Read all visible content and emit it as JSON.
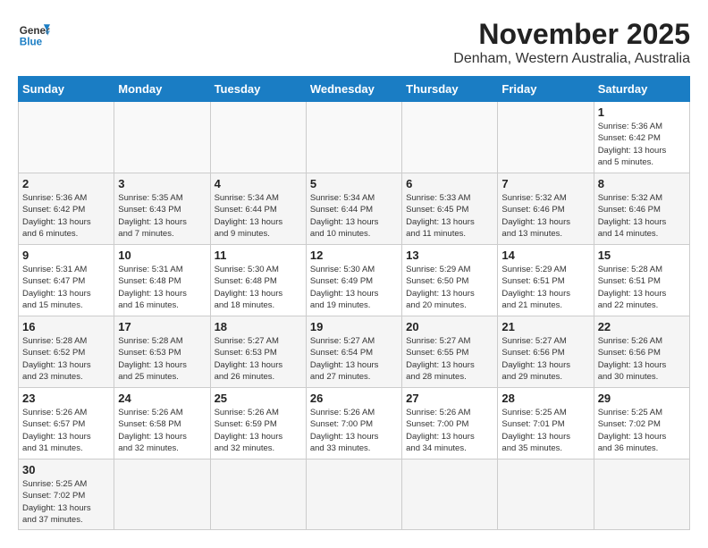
{
  "header": {
    "logo_general": "General",
    "logo_blue": "Blue",
    "title": "November 2025",
    "subtitle": "Denham, Western Australia, Australia"
  },
  "weekdays": [
    "Sunday",
    "Monday",
    "Tuesday",
    "Wednesday",
    "Thursday",
    "Friday",
    "Saturday"
  ],
  "weeks": [
    [
      {
        "day": "",
        "info": ""
      },
      {
        "day": "",
        "info": ""
      },
      {
        "day": "",
        "info": ""
      },
      {
        "day": "",
        "info": ""
      },
      {
        "day": "",
        "info": ""
      },
      {
        "day": "",
        "info": ""
      },
      {
        "day": "1",
        "info": "Sunrise: 5:36 AM\nSunset: 6:42 PM\nDaylight: 13 hours\nand 5 minutes."
      }
    ],
    [
      {
        "day": "2",
        "info": "Sunrise: 5:36 AM\nSunset: 6:42 PM\nDaylight: 13 hours\nand 6 minutes."
      },
      {
        "day": "3",
        "info": "Sunrise: 5:35 AM\nSunset: 6:43 PM\nDaylight: 13 hours\nand 7 minutes."
      },
      {
        "day": "4",
        "info": "Sunrise: 5:34 AM\nSunset: 6:44 PM\nDaylight: 13 hours\nand 9 minutes."
      },
      {
        "day": "5",
        "info": "Sunrise: 5:34 AM\nSunset: 6:44 PM\nDaylight: 13 hours\nand 10 minutes."
      },
      {
        "day": "6",
        "info": "Sunrise: 5:33 AM\nSunset: 6:45 PM\nDaylight: 13 hours\nand 11 minutes."
      },
      {
        "day": "7",
        "info": "Sunrise: 5:32 AM\nSunset: 6:46 PM\nDaylight: 13 hours\nand 13 minutes."
      },
      {
        "day": "8",
        "info": "Sunrise: 5:32 AM\nSunset: 6:46 PM\nDaylight: 13 hours\nand 14 minutes."
      }
    ],
    [
      {
        "day": "9",
        "info": "Sunrise: 5:31 AM\nSunset: 6:47 PM\nDaylight: 13 hours\nand 15 minutes."
      },
      {
        "day": "10",
        "info": "Sunrise: 5:31 AM\nSunset: 6:48 PM\nDaylight: 13 hours\nand 16 minutes."
      },
      {
        "day": "11",
        "info": "Sunrise: 5:30 AM\nSunset: 6:48 PM\nDaylight: 13 hours\nand 18 minutes."
      },
      {
        "day": "12",
        "info": "Sunrise: 5:30 AM\nSunset: 6:49 PM\nDaylight: 13 hours\nand 19 minutes."
      },
      {
        "day": "13",
        "info": "Sunrise: 5:29 AM\nSunset: 6:50 PM\nDaylight: 13 hours\nand 20 minutes."
      },
      {
        "day": "14",
        "info": "Sunrise: 5:29 AM\nSunset: 6:51 PM\nDaylight: 13 hours\nand 21 minutes."
      },
      {
        "day": "15",
        "info": "Sunrise: 5:28 AM\nSunset: 6:51 PM\nDaylight: 13 hours\nand 22 minutes."
      }
    ],
    [
      {
        "day": "16",
        "info": "Sunrise: 5:28 AM\nSunset: 6:52 PM\nDaylight: 13 hours\nand 23 minutes."
      },
      {
        "day": "17",
        "info": "Sunrise: 5:28 AM\nSunset: 6:53 PM\nDaylight: 13 hours\nand 25 minutes."
      },
      {
        "day": "18",
        "info": "Sunrise: 5:27 AM\nSunset: 6:53 PM\nDaylight: 13 hours\nand 26 minutes."
      },
      {
        "day": "19",
        "info": "Sunrise: 5:27 AM\nSunset: 6:54 PM\nDaylight: 13 hours\nand 27 minutes."
      },
      {
        "day": "20",
        "info": "Sunrise: 5:27 AM\nSunset: 6:55 PM\nDaylight: 13 hours\nand 28 minutes."
      },
      {
        "day": "21",
        "info": "Sunrise: 5:27 AM\nSunset: 6:56 PM\nDaylight: 13 hours\nand 29 minutes."
      },
      {
        "day": "22",
        "info": "Sunrise: 5:26 AM\nSunset: 6:56 PM\nDaylight: 13 hours\nand 30 minutes."
      }
    ],
    [
      {
        "day": "23",
        "info": "Sunrise: 5:26 AM\nSunset: 6:57 PM\nDaylight: 13 hours\nand 31 minutes."
      },
      {
        "day": "24",
        "info": "Sunrise: 5:26 AM\nSunset: 6:58 PM\nDaylight: 13 hours\nand 32 minutes."
      },
      {
        "day": "25",
        "info": "Sunrise: 5:26 AM\nSunset: 6:59 PM\nDaylight: 13 hours\nand 32 minutes."
      },
      {
        "day": "26",
        "info": "Sunrise: 5:26 AM\nSunset: 7:00 PM\nDaylight: 13 hours\nand 33 minutes."
      },
      {
        "day": "27",
        "info": "Sunrise: 5:26 AM\nSunset: 7:00 PM\nDaylight: 13 hours\nand 34 minutes."
      },
      {
        "day": "28",
        "info": "Sunrise: 5:25 AM\nSunset: 7:01 PM\nDaylight: 13 hours\nand 35 minutes."
      },
      {
        "day": "29",
        "info": "Sunrise: 5:25 AM\nSunset: 7:02 PM\nDaylight: 13 hours\nand 36 minutes."
      }
    ],
    [
      {
        "day": "30",
        "info": "Sunrise: 5:25 AM\nSunset: 7:02 PM\nDaylight: 13 hours\nand 37 minutes."
      },
      {
        "day": "",
        "info": ""
      },
      {
        "day": "",
        "info": ""
      },
      {
        "day": "",
        "info": ""
      },
      {
        "day": "",
        "info": ""
      },
      {
        "day": "",
        "info": ""
      },
      {
        "day": "",
        "info": ""
      }
    ]
  ]
}
